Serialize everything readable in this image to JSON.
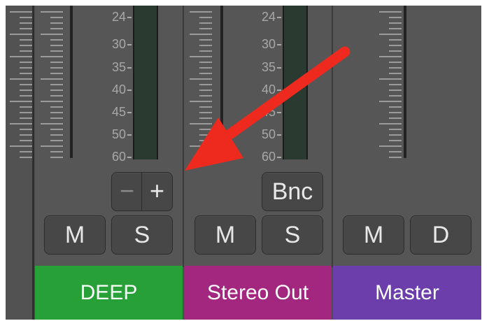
{
  "meter_scale": [
    "24",
    "30",
    "35",
    "40",
    "45",
    "50",
    "60"
  ],
  "channels": [
    {
      "name": "DEEP",
      "color": "#27a038",
      "stepper": {
        "minus": "−",
        "plus": "+"
      },
      "buttons": [
        "M",
        "S"
      ]
    },
    {
      "name": "Stereo Out",
      "color": "#a3277f",
      "bounce": "Bnc",
      "buttons": [
        "M",
        "S"
      ]
    },
    {
      "name": "Master",
      "color": "#6b3eab",
      "buttons": [
        "M",
        "D"
      ]
    }
  ],
  "annotation": {
    "type": "arrow",
    "color": "#ee2a1e"
  }
}
